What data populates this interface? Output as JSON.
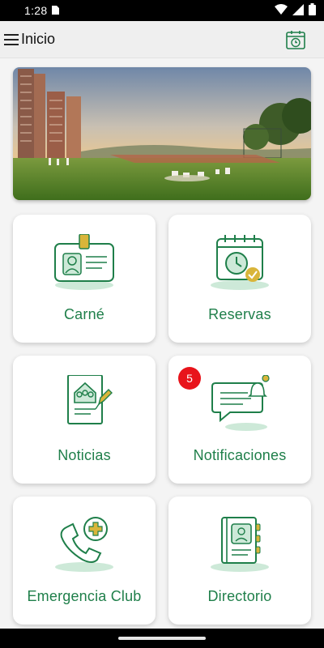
{
  "status_bar": {
    "time": "1:28"
  },
  "app_bar": {
    "title": "Inicio"
  },
  "colors": {
    "brand_green": "#1f7f4a",
    "badge_red": "#e8141b",
    "light_green": "#cde9d8"
  },
  "tiles": [
    {
      "label": "Carné",
      "icon": "id-card-icon"
    },
    {
      "label": "Reservas",
      "icon": "calendar-clock-icon"
    },
    {
      "label": "Noticias",
      "icon": "news-document-icon"
    },
    {
      "label": "Notificaciones",
      "icon": "chat-bell-icon",
      "badge": "5"
    },
    {
      "label": "Emergencia Club",
      "icon": "phone-medical-icon"
    },
    {
      "label": "Directorio",
      "icon": "contact-book-icon"
    }
  ]
}
